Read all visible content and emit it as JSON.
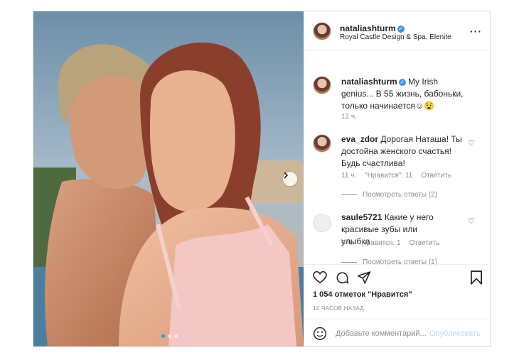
{
  "post": {
    "author": "nataliashturm",
    "location": "Royal Castle Design & Spa. Elenite",
    "caption_author": "nataliashturm",
    "caption_text": "My Irish genius... В 55 жизнь, бабоньки, только начинается☺😧",
    "caption_time": "12 ч."
  },
  "comments": [
    {
      "author": "eva_zdor",
      "text": "Дорогая Наташа! Ты достойна женского счастья! Будь счастлива!",
      "time": "11 ч.",
      "likes": "\"Нравится\": 11",
      "reply": "Ответить",
      "view_replies": "Посмотреть ответы (2)"
    },
    {
      "author": "saule5721",
      "text": "Какие у него красивые зубы или улыбка",
      "time": "9 ч.",
      "likes": "Нравится: 1",
      "reply": "Ответить",
      "view_replies": "Посмотреть ответы (1)"
    }
  ],
  "actions": {
    "likes_count": "1 054 отметок \"Нравится\"",
    "time_ago": "12 ЧАСОВ НАЗАД"
  },
  "comment_box": {
    "placeholder": "Добавьте комментарий...",
    "publish_label": "Опубликовать"
  },
  "carousel": {
    "total": 3,
    "active": 1
  },
  "colors": {
    "verified": "#3897f0",
    "publish_disabled": "#b2dffc",
    "muted": "#8e8e8e"
  },
  "icons": [
    "chevron-right-icon",
    "more-icon",
    "heart-icon",
    "comment-icon",
    "share-icon",
    "bookmark-icon",
    "emoji-icon",
    "verified-icon"
  ]
}
